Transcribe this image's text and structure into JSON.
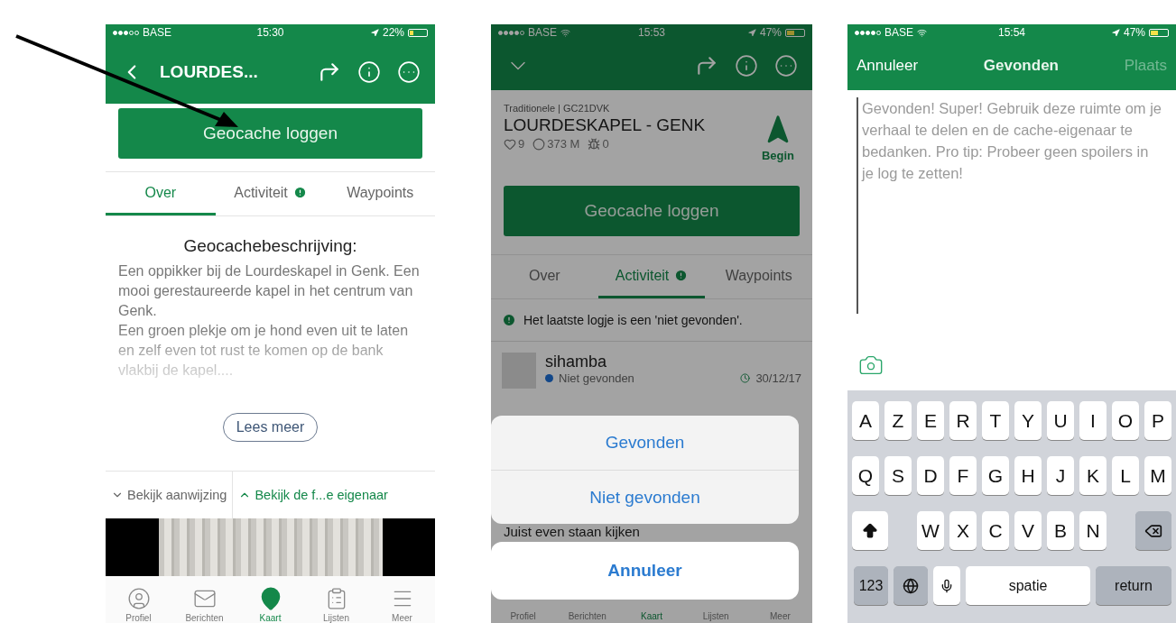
{
  "screen_1": {
    "status_bar": {
      "carrier": "BASE",
      "time": "15:30",
      "battery": "22%"
    },
    "header": {
      "title": "LOURDES..."
    },
    "log_button": "Geocache loggen",
    "tabs": [
      {
        "label": "Over",
        "selected": true,
        "alert": false
      },
      {
        "label": "Activiteit",
        "selected": false,
        "alert": true
      },
      {
        "label": "Waypoints",
        "selected": false,
        "alert": false
      }
    ],
    "description": {
      "heading": "Geocachebeschrijving:",
      "paragraphs": [
        "Een oppikker bij de Lourdeskapel in Genk. Een mooi gerestaureerde kapel in het centrum van Genk.",
        "Een groen plekje om je hond even uit te laten en zelf even tot rust te komen op de bank vlakbij de kapel...."
      ]
    },
    "read_more": "Lees meer",
    "hint_links": [
      {
        "label": "Bekijk aanwijzing",
        "expanded": false
      },
      {
        "label": "Bekijk de f...e eigenaar",
        "expanded": true
      }
    ],
    "tab_bar": [
      {
        "label": "Profiel",
        "selected": false
      },
      {
        "label": "Berichten",
        "selected": false
      },
      {
        "label": "Kaart",
        "selected": true
      },
      {
        "label": "Lijsten",
        "selected": false
      },
      {
        "label": "Meer",
        "selected": false
      }
    ]
  },
  "screen_2": {
    "status_bar": {
      "carrier": "BASE",
      "time": "15:53",
      "battery": "47%"
    },
    "cache": {
      "type_code": "Traditionele | GC21DVK",
      "name": "LOURDESKAPEL - GENK",
      "favorites": "9",
      "distance": "373 M",
      "trackables": "0",
      "start": "Begin"
    },
    "log_button": "Geocache loggen",
    "tabs": [
      {
        "label": "Over",
        "selected": false,
        "alert": false
      },
      {
        "label": "Activiteit",
        "selected": true,
        "alert": true
      },
      {
        "label": "Waypoints",
        "selected": false,
        "alert": false
      }
    ],
    "notice": "Het laatste logje is een 'niet gevonden'.",
    "log": {
      "user": "sihamba",
      "status": "Niet gevonden",
      "date": "30/12/17",
      "text": "Juist even staan kijken"
    },
    "action_sheet": {
      "options": [
        "Gevonden",
        "Niet gevonden"
      ],
      "cancel": "Annuleer"
    },
    "tab_bar": [
      {
        "label": "Profiel",
        "selected": false
      },
      {
        "label": "Berichten",
        "selected": false
      },
      {
        "label": "Kaart",
        "selected": true
      },
      {
        "label": "Lijsten",
        "selected": false
      },
      {
        "label": "Meer",
        "selected": false
      }
    ]
  },
  "screen_3": {
    "status_bar": {
      "carrier": "BASE",
      "time": "15:54",
      "battery": "47%"
    },
    "nav": {
      "cancel": "Annuleer",
      "title": "Gevonden",
      "post": "Plaats",
      "post_disabled": true
    },
    "log_field": {
      "placeholder": "Gevonden! Super! Gebruik deze ruimte om je verhaal te delen en de cache-eigenaar te bedanken. Pro tip: Probeer geen spoilers in je log te zetten!"
    },
    "keyboard": {
      "rows": [
        [
          "A",
          "Z",
          "E",
          "R",
          "T",
          "Y",
          "U",
          "I",
          "O",
          "P"
        ],
        [
          "Q",
          "S",
          "D",
          "F",
          "G",
          "H",
          "J",
          "K",
          "L",
          "M"
        ]
      ],
      "shift_row": [
        "W",
        "X",
        "C",
        "V",
        "B",
        "N"
      ],
      "numbers_key": "123",
      "space_key": "spatie",
      "return_key": "return"
    }
  }
}
